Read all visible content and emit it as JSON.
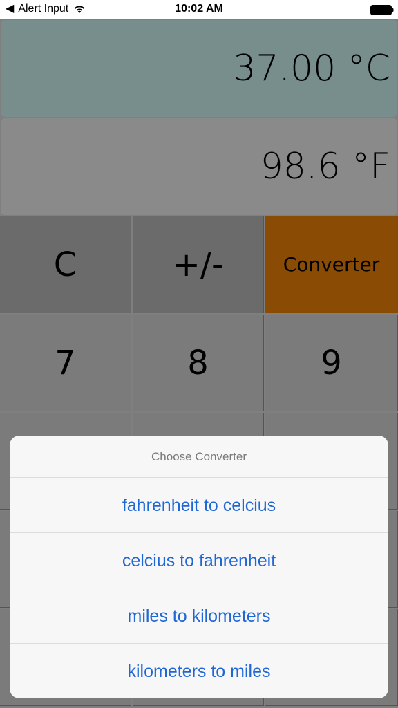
{
  "status_bar": {
    "back_app": "Alert Input",
    "time": "10:02 AM"
  },
  "displays": {
    "primary": "37.00 °C",
    "secondary": "98.6 °F"
  },
  "keypad": {
    "row1": [
      "C",
      "+/-",
      "Converter"
    ],
    "row2": [
      "7",
      "8",
      "9"
    ]
  },
  "sheet": {
    "title": "Choose Converter",
    "options": [
      "fahrenheit to celcius",
      "celcius to fahrenheit",
      "miles to kilometers",
      "kilometers to miles"
    ]
  },
  "colors": {
    "accent_orange": "#8a4b05",
    "link_blue": "#1f66d6",
    "display_top": "#778e8d"
  }
}
